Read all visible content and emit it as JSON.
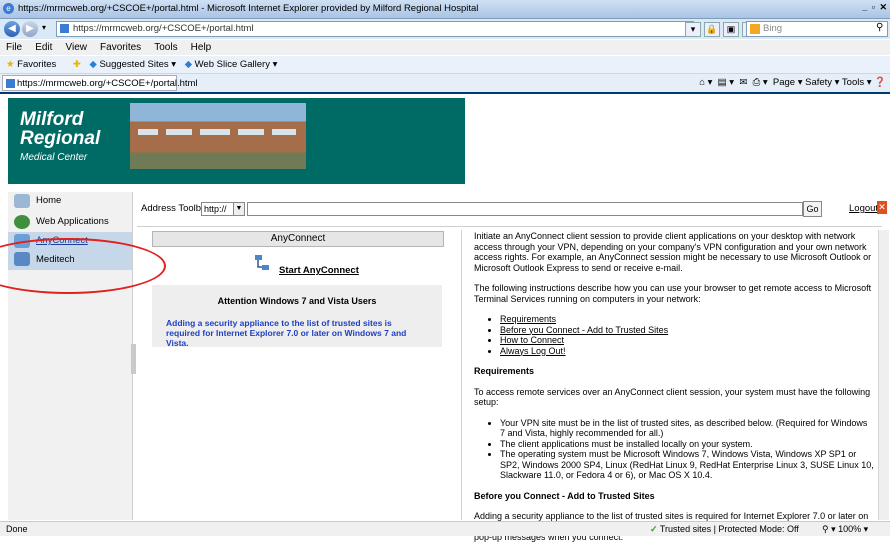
{
  "window": {
    "title": "https://mrmcweb.org/+CSCOE+/portal.html - Microsoft Internet Explorer provided by Milford Regional Hospital",
    "controls": "_ ▫ ✕"
  },
  "browser": {
    "url": "https://mrmcweb.org/+CSCOE+/portal.html",
    "search_placeholder": "Bing",
    "menu": [
      "File",
      "Edit",
      "View",
      "Favorites",
      "Tools",
      "Help"
    ],
    "favorites_label": "Favorites",
    "suggested_sites": "Suggested Sites ▾",
    "web_slice_gallery": "Web Slice Gallery ▾",
    "tab_title": "https://mrmcweb.org/+CSCOE+/portal.html",
    "command_bar": "Page ▾  Safety ▾  Tools ▾"
  },
  "banner": {
    "line1": "Milford",
    "line2": "Regional",
    "line3": "Medical Center"
  },
  "nav": {
    "items": [
      {
        "label": "Home"
      },
      {
        "label": "Web Applications"
      },
      {
        "label": "AnyConnect"
      },
      {
        "label": "Meditech"
      }
    ]
  },
  "toolbar": {
    "address_label": "Address Toolbar",
    "protocol": "http://",
    "go_label": "Go",
    "logout_label": "Logout"
  },
  "anyconnect": {
    "header": "AnyConnect",
    "start_label": "Start AnyConnect",
    "attention_title": "Attention Windows 7 and Vista Users",
    "attention_body": "Adding a security appliance to the list of trusted sites is required for Internet Explorer 7.0 or later on Windows 7 and Vista."
  },
  "content": {
    "intro": "Initiate an AnyConnect client session to provide client applications on your desktop with network access through your VPN, depending on your company's VPN configuration and your own network access rights. For example, an AnyConnect session might be necessary to use Microsoft Outlook or Microsoft Outlook Express to send or receive e-mail.",
    "instructions": "The following instructions describe how you can use your browser to get remote access to Microsoft Terminal Services running on computers in your network:",
    "links": [
      "Requirements",
      "Before you Connect - Add to Trusted Sites",
      "How to Connect",
      "Always Log Out!"
    ],
    "req_heading": "Requirements",
    "req_intro": "To access remote services over an AnyConnect client session, your system must have the following setup:",
    "req_items": [
      "Your VPN site must be in the list of trusted sites, as described below. (Required for Windows 7 and Vista, highly recommended for all.)",
      "The client applications must be installed locally on your system.",
      "The operating system must be Microsoft Windows 7, Windows Vista, Windows XP SP1 or SP2, Windows 2000 SP4, Linux (RedHat Linux 9, RedHat Enterprise Linux 3, SUSE Linux 10, Slackware 11.0, or Fedora 4 or 6), or Mac OS X 10.4."
    ],
    "trusted_heading": "Before you Connect - Add to Trusted Sites",
    "trusted_body": "Adding a security appliance to the list of trusted sites is required for Internet Explorer 7.0 or later on Windows 7 and Vista. We also recommend the procedure for others to eliminate certain security pop-up messages when you connect."
  },
  "status": {
    "left": "Done",
    "zone": "Trusted sites | Protected Mode: Off",
    "zoom": "100%"
  },
  "colors": {
    "banner_bg": "#006a65",
    "attention_text": "#1f3fbf",
    "annotation": "#e0211e"
  }
}
